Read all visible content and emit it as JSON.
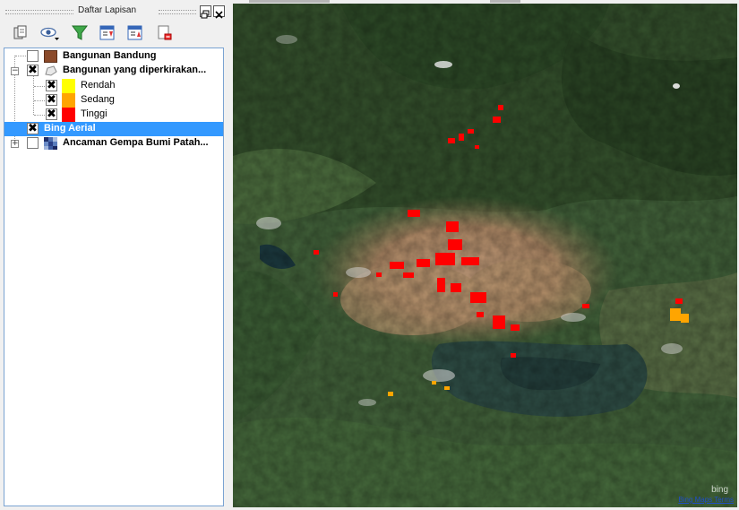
{
  "panel": {
    "title": "Daftar Lapisan",
    "toolbar": [
      {
        "icon": "add-group-icon"
      },
      {
        "icon": "visibility-eye-icon"
      },
      {
        "icon": "filter-funnel-icon"
      },
      {
        "icon": "expand-all-icon"
      },
      {
        "icon": "collapse-all-icon"
      },
      {
        "icon": "remove-layer-icon"
      }
    ]
  },
  "layers": [
    {
      "label": "Bangunan Bandung",
      "checked": false,
      "bold": true,
      "swatch_color": "#8b4a2a"
    },
    {
      "label": "Bangunan yang diperkirakan...",
      "checked": true,
      "bold": true,
      "icon": "polygon-layer-icon"
    },
    {
      "label": "Rendah",
      "checked": true,
      "bold": false,
      "swatch_color": "#ffff00"
    },
    {
      "label": "Sedang",
      "checked": true,
      "bold": false,
      "swatch_color": "#ffa500"
    },
    {
      "label": "Tinggi",
      "checked": true,
      "bold": false,
      "swatch_color": "#ff0000"
    },
    {
      "label": "Bing Aerial",
      "checked": true,
      "bold": true,
      "selected": true
    },
    {
      "label": "Ancaman Gempa Bumi Patah...",
      "checked": false,
      "bold": true,
      "icon": "raster-layer-icon"
    }
  ],
  "map": {
    "attribution": "Bing Maps Terms",
    "watermark": "bing",
    "colors": {
      "high": "#ff0000",
      "medium": "#ffa500",
      "low": "#ffff00"
    }
  }
}
